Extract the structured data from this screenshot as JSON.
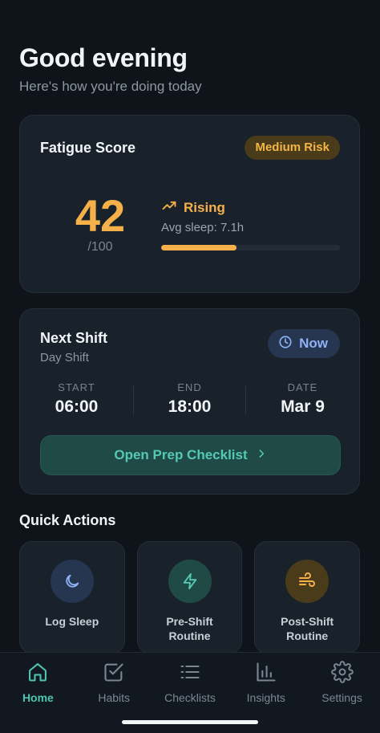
{
  "header": {
    "greeting": "Good evening",
    "subtitle": "Here's how you're doing today"
  },
  "fatigue": {
    "title": "Fatigue Score",
    "risk_label": "Medium Risk",
    "score": "42",
    "score_max": "/100",
    "trend_label": "Rising",
    "avg_sleep": "Avg sleep: 7.1h",
    "bar_fraction": 0.42
  },
  "shift": {
    "title": "Next Shift",
    "type": "Day Shift",
    "status": "Now",
    "columns": [
      {
        "label": "START",
        "value": "06:00"
      },
      {
        "label": "END",
        "value": "18:00"
      },
      {
        "label": "DATE",
        "value": "Mar 9"
      }
    ],
    "cta": "Open Prep Checklist"
  },
  "quick_actions": {
    "title": "Quick Actions",
    "items": [
      {
        "label": "Log Sleep",
        "icon": "moon-icon"
      },
      {
        "label": "Pre-Shift Routine",
        "icon": "lightning-icon"
      },
      {
        "label": "Post-Shift Routine",
        "icon": "wind-icon"
      }
    ]
  },
  "tabs": [
    {
      "label": "Home",
      "icon": "home-icon",
      "active": true
    },
    {
      "label": "Habits",
      "icon": "checkbox-icon"
    },
    {
      "label": "Checklists",
      "icon": "list-icon"
    },
    {
      "label": "Insights",
      "icon": "bar-chart-icon"
    },
    {
      "label": "Settings",
      "icon": "gear-icon"
    }
  ],
  "colors": {
    "accent_teal": "#4fc4b0",
    "accent_amber": "#f5b04a",
    "accent_blue": "#8eb2f5",
    "background": "#0f141a",
    "card": "#19212b"
  }
}
